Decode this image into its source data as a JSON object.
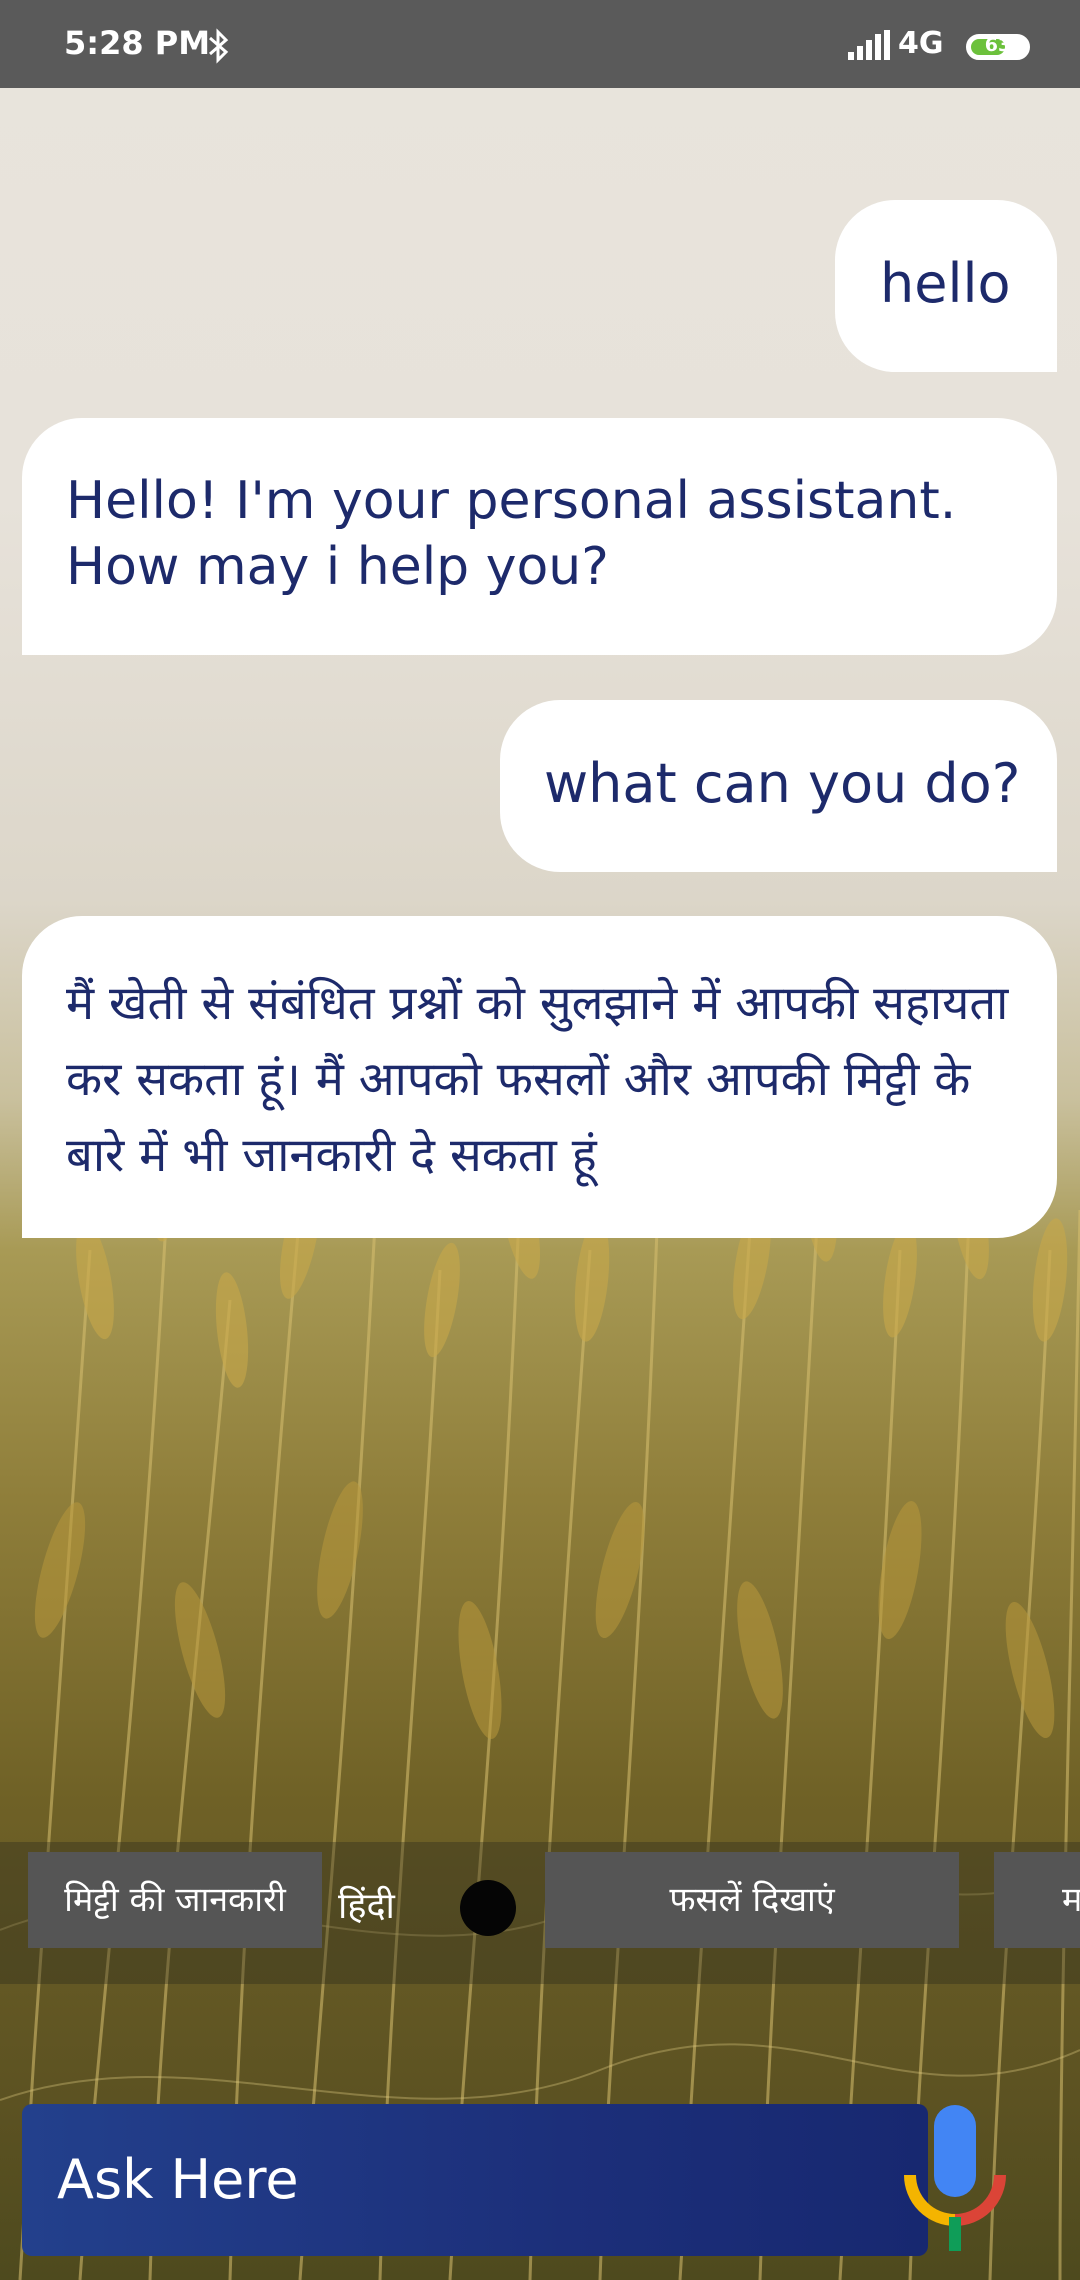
{
  "status_bar": {
    "time": "5:28 PM",
    "network": "4G",
    "battery": "63",
    "battery_level": 0.63
  },
  "messages": [
    {
      "sender": "user",
      "text": "hello"
    },
    {
      "sender": "bot",
      "text": "Hello! I'm your personal assistant. How may i help you?"
    },
    {
      "sender": "user",
      "text": "what can you do?"
    },
    {
      "sender": "bot",
      "text": "मैं खेती से संबंधित प्रश्नों को सुलझाने में आपकी सहायता कर सकता हूं। मैं आपको फसलों और आपकी मिट्टी के बारे में भी जानकारी दे सकता हूं"
    }
  ],
  "quick_replies": {
    "soil_info": "मिट्टी की जानकारी",
    "language_label": "हिंदी",
    "show_crops": "फसलें दिखाएं",
    "more": "म"
  },
  "ask": {
    "placeholder": "Ask Here"
  },
  "colors": {
    "status_bar_bg": "#5a5a5a",
    "bubble_text": "#1d2a6b",
    "chip_bg": "#555555",
    "ask_bg": "#1c2f7a",
    "battery_green": "#6cc13c"
  },
  "icons": [
    "bluetooth-icon",
    "signal-icon",
    "battery-icon",
    "microphone-icon"
  ]
}
